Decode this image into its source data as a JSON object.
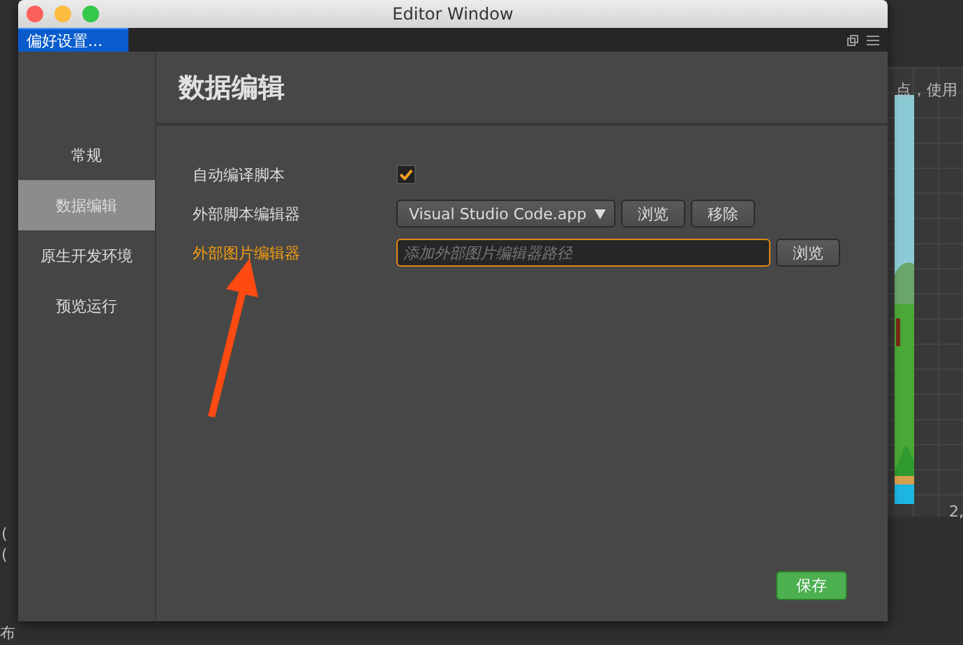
{
  "window": {
    "title": "Editor Window"
  },
  "tabs": [
    {
      "label": "偏好设置...",
      "selected": true
    }
  ],
  "sidebar": {
    "items": [
      {
        "label": "常规",
        "selected": false
      },
      {
        "label": "数据编辑",
        "selected": true
      },
      {
        "label": "原生开发环境",
        "selected": false
      },
      {
        "label": "预览运行",
        "selected": false
      }
    ]
  },
  "heading": "数据编辑",
  "settings": [
    {
      "kind": "checkbox",
      "label": "自动编译脚本",
      "highlighted": false,
      "checked": true
    },
    {
      "kind": "dropdown",
      "label": "外部脚本编辑器",
      "highlighted": false,
      "value": "Visual Studio Code.app",
      "buttons": [
        "浏览",
        "移除"
      ]
    },
    {
      "kind": "field",
      "label": "外部图片编辑器",
      "highlighted": true,
      "placeholder": "添加外部图片编辑器路径",
      "buttons": [
        "浏览"
      ]
    }
  ],
  "save_button": "保存",
  "background": {
    "hint": "点，使用",
    "coordinate": "2,",
    "left_items": [
      "(",
      "("
    ],
    "bottom_left": "布"
  }
}
